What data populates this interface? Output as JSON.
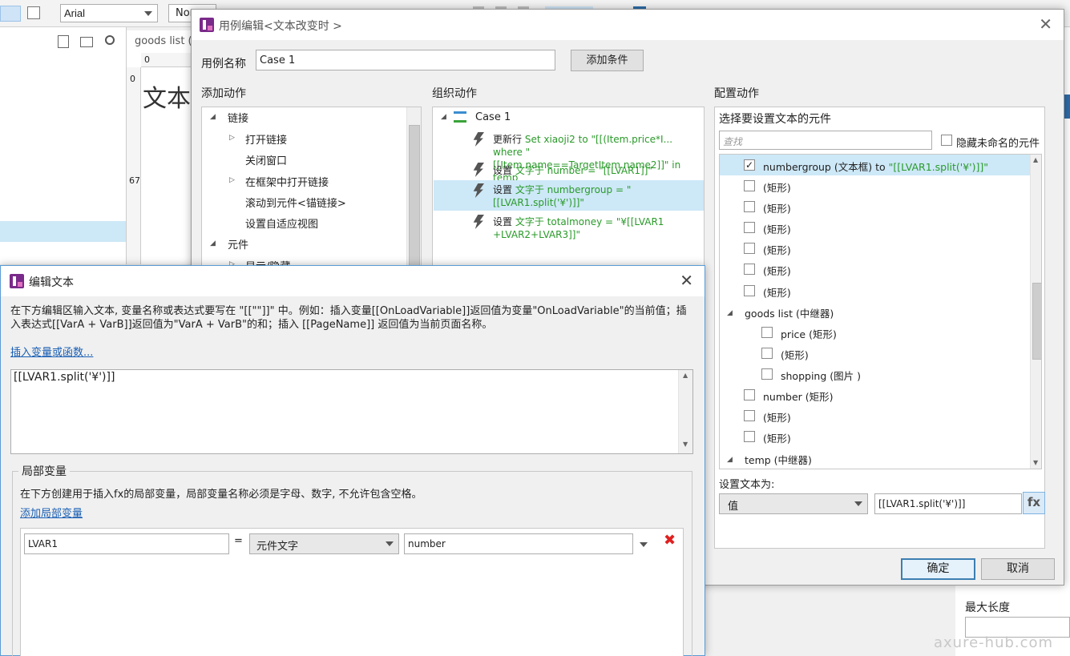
{
  "bg": {
    "font": "Arial",
    "font_partial": "Nor",
    "tab": "goods list (N",
    "ruler_x0": "0",
    "ruler_y0": "0",
    "ruler_y67": "67",
    "canvas_text": "文本框",
    "prop_label": "最大长度",
    "watermark": "axure-hub.com"
  },
  "case_dialog": {
    "title": "用例编辑<文本改变时 >",
    "name_label": "用例名称",
    "name_value": "Case 1",
    "add_condition": "添加条件",
    "add_action_header": "添加动作",
    "organize_header": "组织动作",
    "configure_header": "配置动作",
    "ok": "确定",
    "cancel": "取消"
  },
  "add_actions": {
    "items": [
      "链接",
      "打开链接",
      "关闭窗口",
      "在框架中打开链接",
      "滚动到元件<锚链接>",
      "设置自适应视图",
      "元件",
      "显示/隐藏"
    ]
  },
  "organize": {
    "case_label": "Case 1",
    "actions": [
      {
        "verb": "更新行",
        "detail": "Set xiaoji2 to \"[[(Item.price*I... where \"[[Item.name==TargetItem.name2]]\" in temp"
      },
      {
        "verb": "设置",
        "detail": "文字于 number = \"[[LVAR1]]\""
      },
      {
        "verb": "设置",
        "detail": "文字于 numbergroup = \"[[LVAR1.split('¥')]]\""
      },
      {
        "verb": "设置",
        "detail": "文字于 totalmoney = \"¥[[LVAR1 +LVAR2+LVAR3]]\""
      }
    ]
  },
  "configure": {
    "select_label": "选择要设置文本的元件",
    "search_placeholder": "查找",
    "hide_unnamed": "隐藏未命名的元件",
    "items": [
      {
        "name": "numbergroup (文本框)",
        "extra": " to ",
        "value": "\"[[LVAR1.split('¥')]]\""
      },
      {
        "name": "(矩形)"
      },
      {
        "name": "(矩形)"
      },
      {
        "name": "(矩形)"
      },
      {
        "name": "(矩形)"
      },
      {
        "name": "(矩形)"
      },
      {
        "name": "(矩形)"
      },
      {
        "name": "goods list (中继器)"
      },
      {
        "name": "price (矩形)"
      },
      {
        "name": "(矩形)"
      },
      {
        "name": "shopping (图片 )"
      },
      {
        "name": "number (矩形)"
      },
      {
        "name": "(矩形)"
      },
      {
        "name": "(矩形)"
      },
      {
        "name": "temp (中继器)"
      }
    ],
    "set_text_label": "设置文本为:",
    "mode_value": "值",
    "text_value": "[[LVAR1.split('¥')]]",
    "fx": "fx"
  },
  "edit_dialog": {
    "title": "编辑文本",
    "instructions": "在下方编辑区输入文本, 变量名称或表达式要写在 \"[[\"\"]]\" 中。例如：插入变量[[OnLoadVariable]]返回值为变量\"OnLoadVariable\"的当前值；插入表达式[[VarA + VarB]]返回值为\"VarA + VarB\"的和；插入 [[PageName]] 返回值为当前页面名称。",
    "insert_link": "插入变量或函数...",
    "editor_value": "[[LVAR1.split('¥')]]",
    "local_vars_title": "局部变量",
    "local_vars_desc": "在下方创建用于插入fx的局部变量，局部变量名称必须是字母、数字, 不允许包含空格。",
    "add_local_var": "添加局部变量",
    "var_name": "LVAR1",
    "equals": "=",
    "var_type": "元件文字",
    "var_target": "number"
  }
}
